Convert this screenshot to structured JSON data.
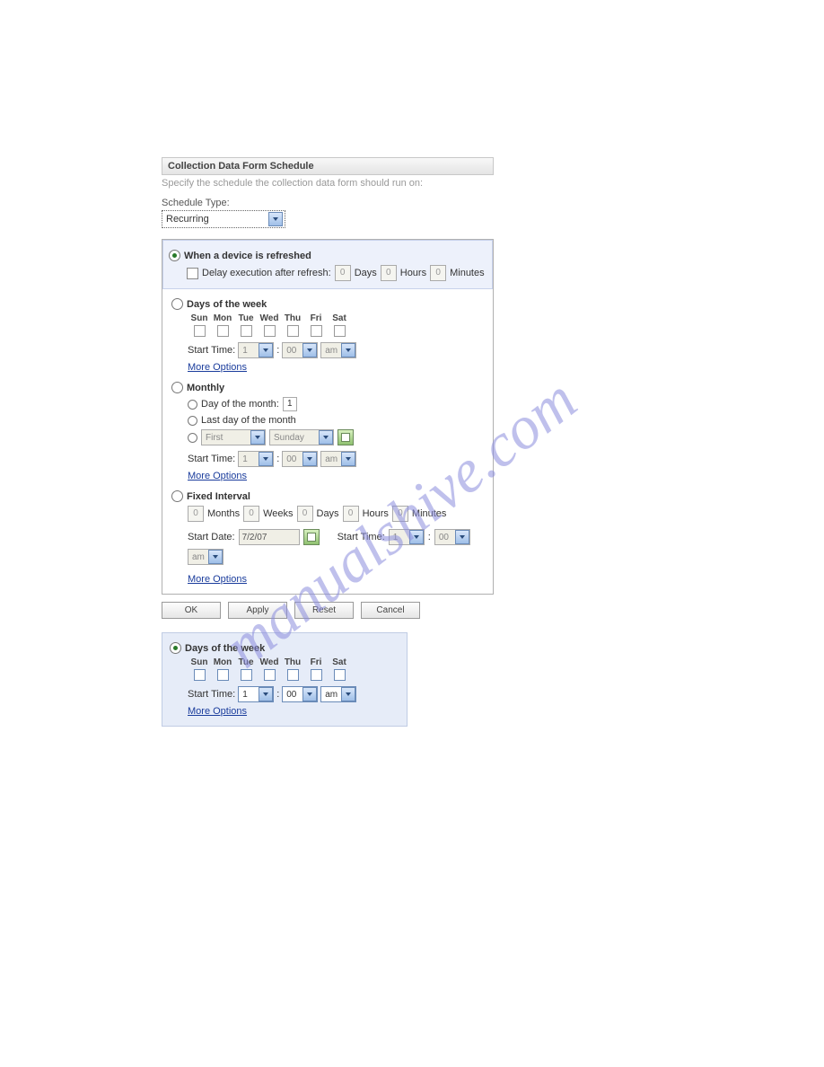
{
  "header": {
    "title": "Collection Data Form Schedule"
  },
  "instruction": "Specify the schedule the collection data form should run on:",
  "schedule_type": {
    "label": "Schedule Type:",
    "selected": "Recurring"
  },
  "refresh": {
    "label": "When a device is refreshed",
    "delay_label": "Delay execution after refresh:",
    "days_val": "0",
    "days_unit": "Days",
    "hours_val": "0",
    "hours_unit": "Hours",
    "minutes_val": "0",
    "minutes_unit": "Minutes"
  },
  "days_of_week": {
    "label": "Days of the week",
    "headers": [
      "Sun",
      "Mon",
      "Tue",
      "Wed",
      "Thu",
      "Fri",
      "Sat"
    ],
    "start_time_label": "Start Time:",
    "hour": "1",
    "minute": "00",
    "ampm": "am",
    "more_options": "More Options"
  },
  "monthly": {
    "label": "Monthly",
    "day_of_month_label": "Day of the month:",
    "day_of_month_val": "1",
    "last_day_label": "Last day of the month",
    "ordinal": "First",
    "weekday": "Sunday",
    "start_time_label": "Start Time:",
    "hour": "1",
    "minute": "00",
    "ampm": "am",
    "more_options": "More Options"
  },
  "fixed_interval": {
    "label": "Fixed Interval",
    "months_val": "0",
    "months_unit": "Months",
    "weeks_val": "0",
    "weeks_unit": "Weeks",
    "days_val": "0",
    "days_unit": "Days",
    "hours_val": "0",
    "hours_unit": "Hours",
    "minutes_val": "0",
    "minutes_unit": "Minutes",
    "start_date_label": "Start Date:",
    "start_date_val": "7/2/07",
    "start_time_label": "Start Time:",
    "hour": "1",
    "minute": "00",
    "ampm": "am",
    "more_options": "More Options"
  },
  "buttons": {
    "ok": "OK",
    "apply": "Apply",
    "reset": "Reset",
    "cancel": "Cancel"
  },
  "lower": {
    "label": "Days of the week",
    "headers": [
      "Sun",
      "Mon",
      "Tue",
      "Wed",
      "Thu",
      "Fri",
      "Sat"
    ],
    "start_time_label": "Start Time:",
    "hour": "1",
    "minute": "00",
    "ampm": "am",
    "more_options": "More Options"
  },
  "watermark": "manualshive.com"
}
